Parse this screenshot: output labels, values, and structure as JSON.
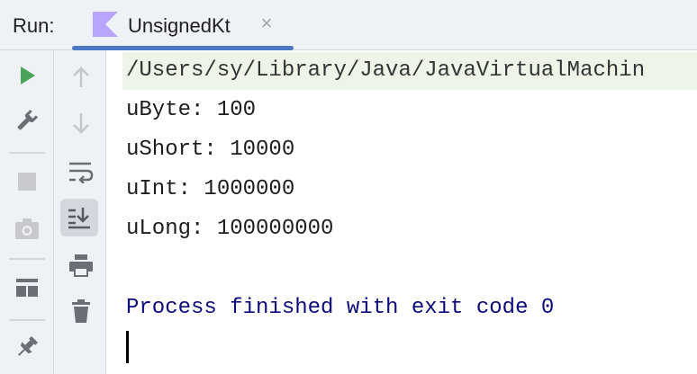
{
  "header": {
    "run_label": "Run:",
    "tab": {
      "title": "UnsignedKt",
      "close_glyph": "×",
      "icon": "kotlin-icon"
    }
  },
  "toolbar_primary": [
    {
      "name": "rerun-icon",
      "tooltip": "Rerun"
    },
    {
      "name": "wrench-icon",
      "tooltip": "Modify run configuration"
    },
    {
      "name": "stop-icon",
      "tooltip": "Stop"
    },
    {
      "name": "camera-icon",
      "tooltip": "Dump threads"
    },
    {
      "name": "layout-icon",
      "tooltip": "Restore layout"
    },
    {
      "name": "pin-icon",
      "tooltip": "Pin tab"
    }
  ],
  "toolbar_secondary": [
    {
      "name": "arrow-up-icon"
    },
    {
      "name": "arrow-down-icon"
    },
    {
      "name": "soft-wrap-icon"
    },
    {
      "name": "scroll-to-end-icon",
      "active": true
    },
    {
      "name": "print-icon"
    },
    {
      "name": "trash-icon"
    }
  ],
  "console": {
    "command": "/Users/sy/Library/Java/JavaVirtualMachin",
    "lines": [
      "uByte: 100",
      "uShort: 10000",
      "uInt: 1000000",
      "uLong: 100000000"
    ],
    "process_line": "Process finished with exit code 0"
  },
  "colors": {
    "run_green": "#4aa35a",
    "accent_blue": "#4a78c2",
    "kotlin_purple": "#b9a5ff",
    "process_text": "#0c0c7a",
    "command_bg": "#edf5e8"
  }
}
